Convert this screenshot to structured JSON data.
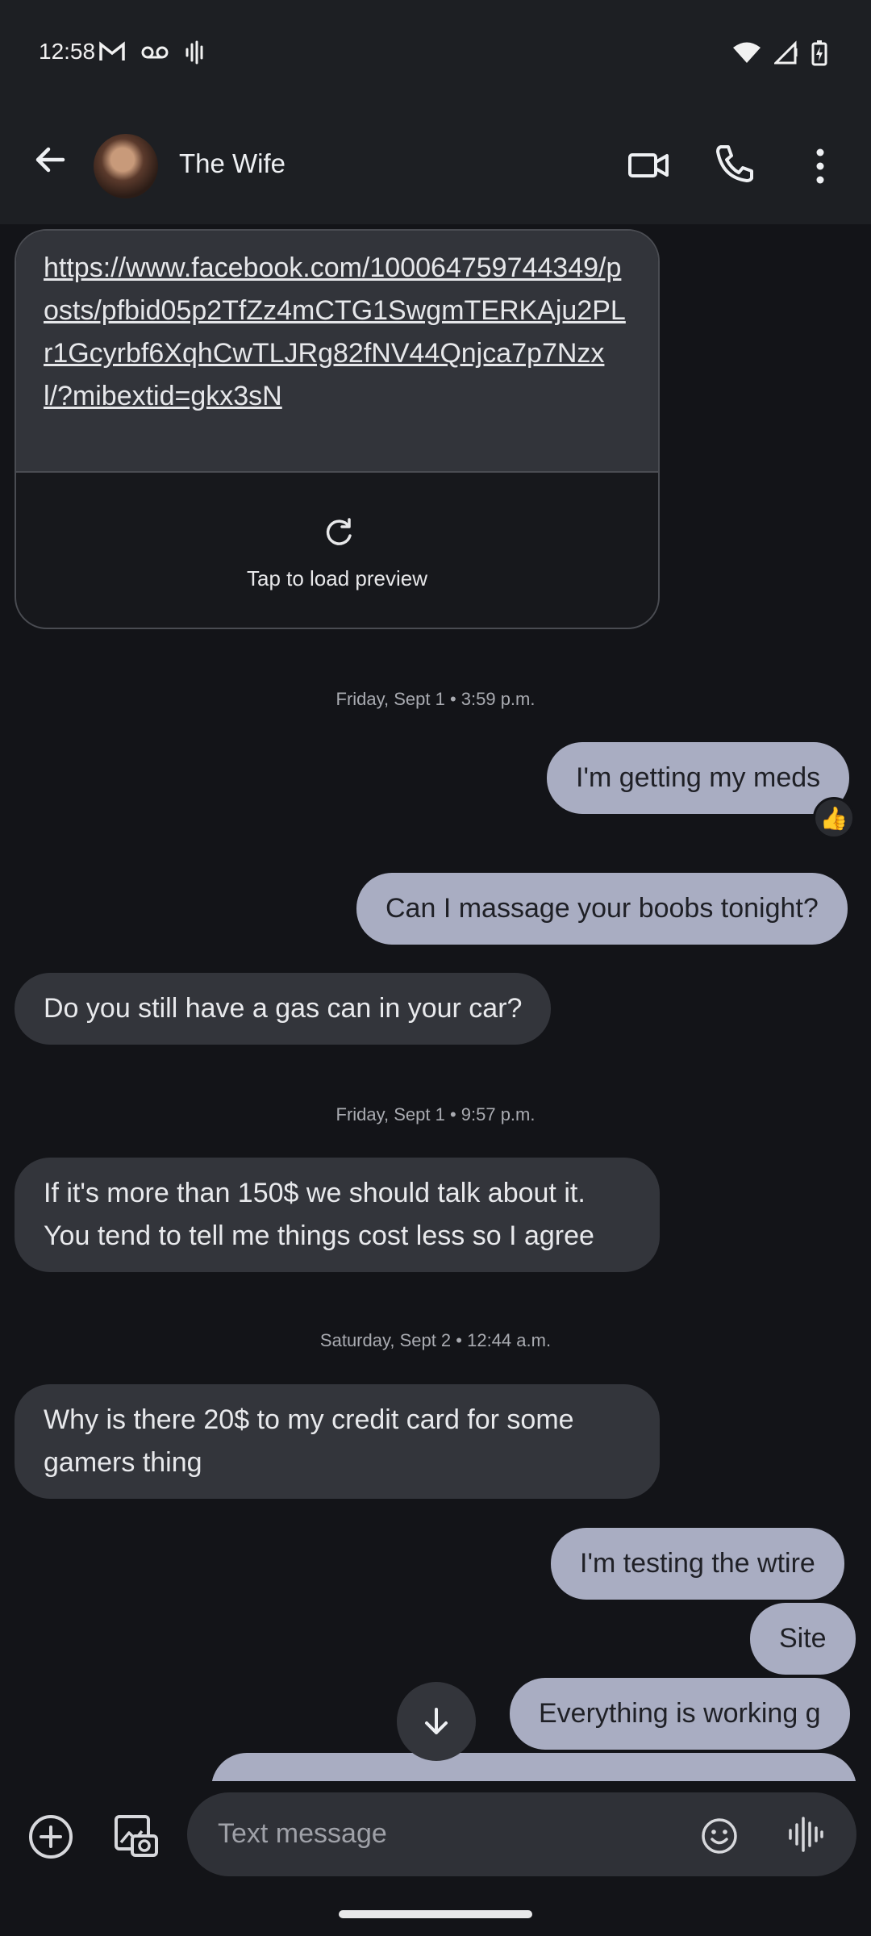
{
  "status_bar": {
    "time": "12:58",
    "left_icons": [
      "gmail-icon",
      "voicemail-icon",
      "sound-wave-icon"
    ],
    "right_icons": [
      "wifi-icon",
      "signal-icon",
      "battery-charging-icon"
    ]
  },
  "header": {
    "contact_name": "The Wife"
  },
  "link_message": {
    "url": "https://www.facebook.com/100064759744349/posts/pfbid05p2TfZz4mCTG1SwgmTERKAju2PLr1Gcyrbf6XqhCwTLJRg82fNV44Qnjca7p7Nzxl/?mibextid=gkx3sN",
    "preview_label": "Tap to load preview"
  },
  "timestamps": {
    "t1": "Friday, Sept 1 • 3:59 p.m.",
    "t2": "Friday, Sept 1 • 9:57 p.m.",
    "t3": "Saturday, Sept 2 • 12:44 a.m."
  },
  "messages": {
    "m1": "I'm getting my meds",
    "m1_reaction": "👍",
    "m2": "Can I massage your boobs tonight?",
    "m3": "Do you still have a gas can in your car?",
    "m4": "If it's more than 150$ we should talk about it. You tend to tell me things cost less so I agree",
    "m5": "Why is there 20$ to my credit card for some gamers thing",
    "m6": "I'm testing the wtire",
    "m7": "Site",
    "m8": "Everything is working g"
  },
  "composer": {
    "placeholder": "Text message"
  },
  "colors": {
    "background": "#131418",
    "bar": "#1d1f23",
    "incoming_bubble": "#33353b",
    "outgoing_bubble": "#a9adc2"
  }
}
